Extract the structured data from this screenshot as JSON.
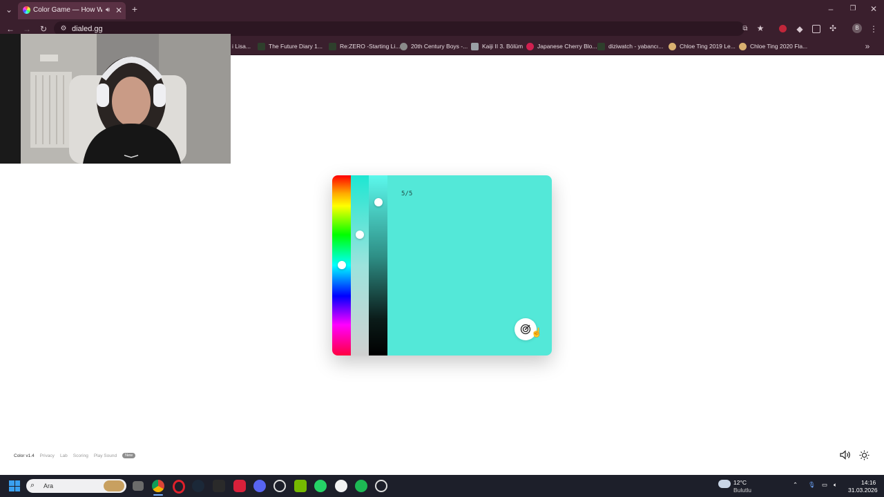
{
  "browser": {
    "tab_title": "Color Game — How Well C",
    "address": "dialed.gg",
    "bookmarks": [
      "i Lisa...",
      "The Future Diary 1...",
      "Re:ZERO -Starting Li...",
      "20th Century Boys -...",
      "Kaiji II 3. Bölüm",
      "Japanese Cherry Blo...",
      "diziwatch - yabancı...",
      "Chloe Ting 2019 Le...",
      "Chloe Ting 2020 Fla..."
    ],
    "profile_initial": "B"
  },
  "game": {
    "progress": "5/5",
    "hue_value": 0.5,
    "saturation_value": 0.33,
    "lightness_value": 0.15,
    "current_color": "#53e8d8",
    "submit_icon": "target-icon"
  },
  "footer": {
    "version": "Color v1.4",
    "links": [
      "Privacy",
      "Lab",
      "Scoring",
      "Play Sound"
    ],
    "badge": "New",
    "sound_icon": "speaker-icon",
    "theme_icon": "sun-icon"
  },
  "taskbar": {
    "search_placeholder": "Ara",
    "weather_temp": "12°C",
    "weather_desc": "Bulutlu",
    "time": "14:16",
    "date": "31.03.2026"
  },
  "colors": {
    "chrome_bg": "#3a1f2d",
    "preview": "#53e8d8",
    "taskbar_bg": "#1d1f2a"
  }
}
